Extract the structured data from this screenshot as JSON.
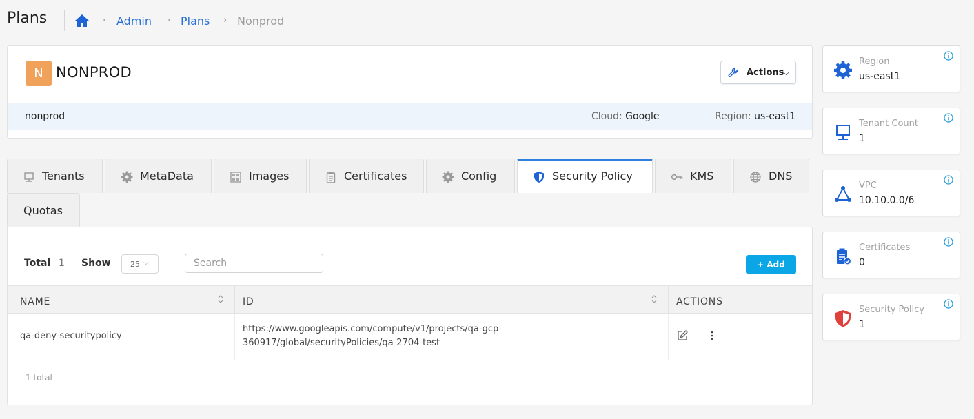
{
  "header": {
    "title": "Plans",
    "breadcrumb": [
      {
        "label": "Admin"
      },
      {
        "label": "Plans"
      },
      {
        "label": "Nonprod"
      }
    ]
  },
  "plan": {
    "avatar_letter": "N",
    "name": "NONPROD",
    "actions_label": "Actions",
    "strip_name": "nonprod",
    "cloud_label": "Cloud:",
    "cloud_value": "Google",
    "region_label": "Region:",
    "region_value": "us-east1"
  },
  "tabs": [
    {
      "label": "Tenants",
      "icon": "monitor-icon"
    },
    {
      "label": "MetaData",
      "icon": "gear-icon"
    },
    {
      "label": "Images",
      "icon": "grid-icon"
    },
    {
      "label": "Certificates",
      "icon": "clipboard-icon"
    },
    {
      "label": "Config",
      "icon": "gear-icon"
    },
    {
      "label": "Security Policy",
      "icon": "shield-icon",
      "active": true
    },
    {
      "label": "KMS",
      "icon": "key-icon"
    },
    {
      "label": "DNS",
      "icon": "globe-icon"
    },
    {
      "label": "Quotas"
    }
  ],
  "toolbar": {
    "total_label": "Total",
    "total_value": "1",
    "show_label": "Show",
    "show_value": "25",
    "search_placeholder": "Search",
    "add_label": "+ Add"
  },
  "table": {
    "columns": [
      "NAME",
      "ID",
      "ACTIONS"
    ],
    "rows": [
      {
        "name": "qa-deny-securitypolicy",
        "id": "https://www.googleapis.com/compute/v1/projects/qa-gcp-360917/global/securityPolicies/qa-2704-test"
      }
    ],
    "footer": "1 total"
  },
  "stats": [
    {
      "label": "Region",
      "value": "us-east1",
      "icon": "gear-icon"
    },
    {
      "label": "Tenant Count",
      "value": "1",
      "icon": "monitor-icon"
    },
    {
      "label": "VPC",
      "value": "10.10.0.0/6",
      "icon": "network-icon"
    },
    {
      "label": "Certificates",
      "value": "0",
      "icon": "clipboard-check-icon"
    },
    {
      "label": "Security Policy",
      "value": "1",
      "icon": "shield-icon"
    }
  ],
  "colors": {
    "accent": "#2f7fdc",
    "add_button": "#0aa6e6",
    "avatar": "#f0a25a",
    "shield_red": "#e0403c"
  }
}
